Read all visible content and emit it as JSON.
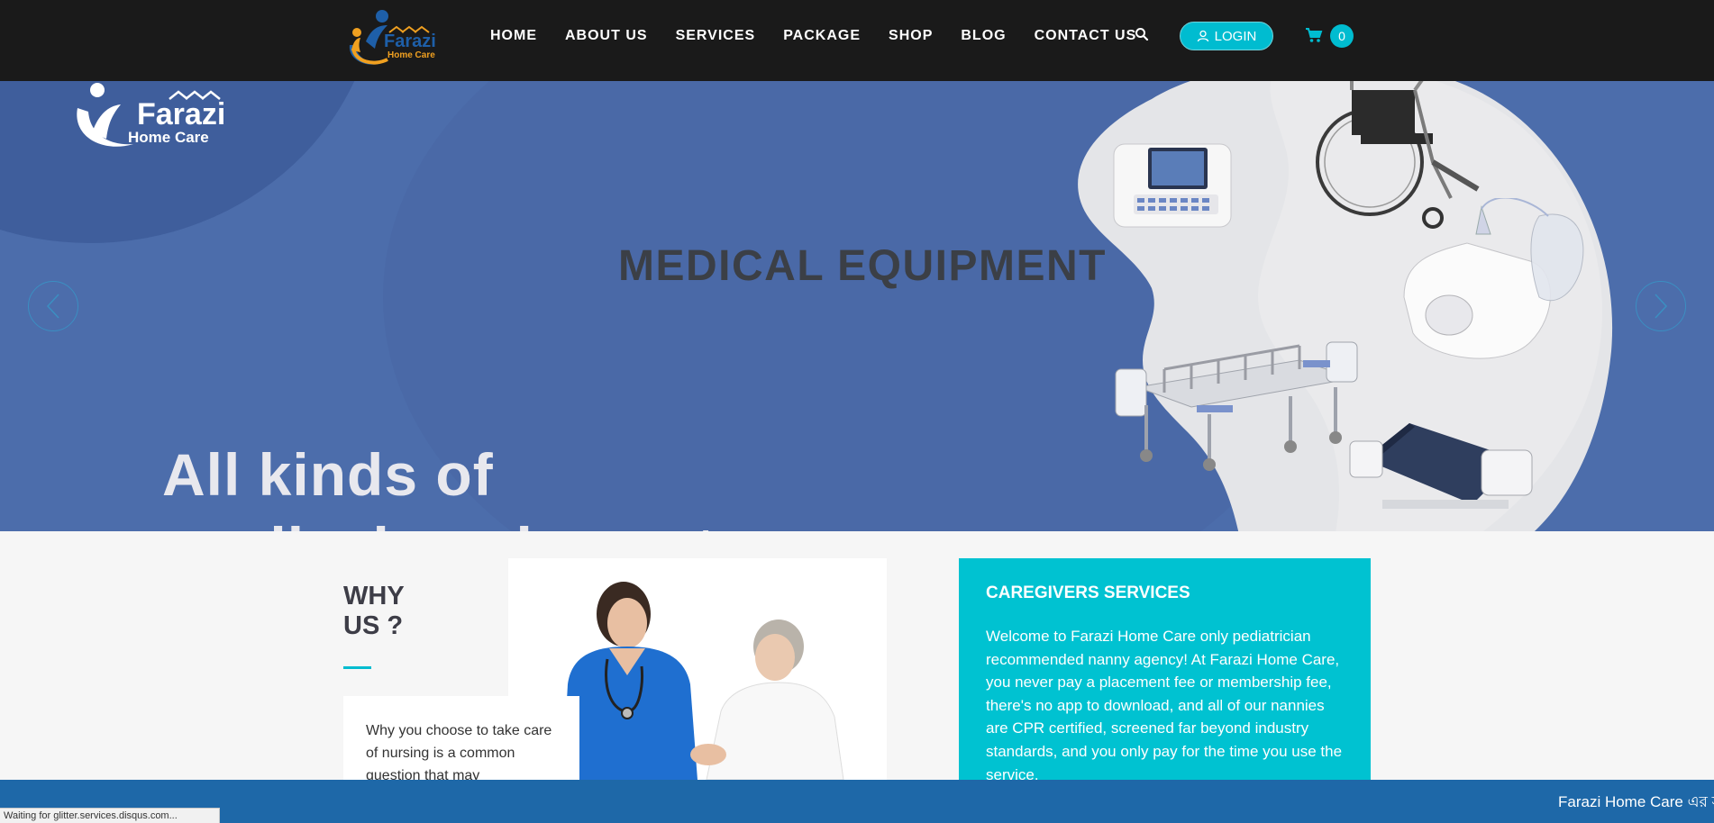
{
  "brand": {
    "name": "Farazi",
    "tagline": "Home Care"
  },
  "nav": {
    "items": [
      "HOME",
      "ABOUT US",
      "SERVICES",
      "PACKAGE",
      "SHOP",
      "BLOG",
      "CONTACT US"
    ],
    "login_label": "LOGIN",
    "cart_count": "0",
    "icons": {
      "search": "search-icon",
      "login": "user-icon",
      "cart": "cart-icon"
    }
  },
  "hero": {
    "title": "MEDICAL EQUIPMENT",
    "subtitle_line1": "All kinds of",
    "subtitle_line2": "medical equipment",
    "badge_brand": "Farazi",
    "badge_tagline": "Home Care"
  },
  "why": {
    "title_line1": "WHY",
    "title_line2": "US ?",
    "body": "Why you choose to take care of nursing is a common question that may"
  },
  "caregivers": {
    "title": "CAREGIVERS SERVICES",
    "body": "Welcome to Farazi Home Care only pediatrician recommended nanny agency! At Farazi Home Care, you never pay a placement fee or membership fee, there's no app to download, and all of our nannies are CPR certified, screened far beyond industry standards, and you only pay for the time you use the service."
  },
  "ticker": {
    "text": "Farazi Home Care এর স"
  },
  "status": {
    "text": "Waiting for glitter.services.disqus.com..."
  },
  "colors": {
    "header_bg": "#1a1a1a",
    "accent": "#00bcd0",
    "hero_bg": "#4c6dab",
    "bottom_bar": "#1e68a8"
  }
}
